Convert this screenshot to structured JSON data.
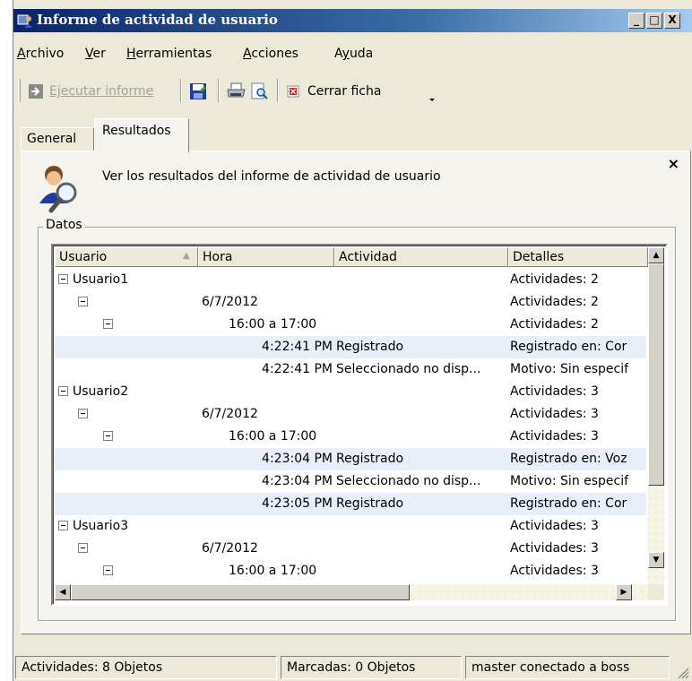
{
  "window": {
    "title": "Informe de actividad de usuario",
    "minimize": "_",
    "maximize": "□",
    "close": "X"
  },
  "menu": [
    {
      "label": "Archivo",
      "accel": "A",
      "rest": "rchivo"
    },
    {
      "label": "Ver",
      "accel": "V",
      "rest": "er"
    },
    {
      "label": "Herramientas",
      "accel": "H",
      "rest": "erramientas"
    },
    {
      "label": "Acciones",
      "accel": "A",
      "rest": "cciones"
    },
    {
      "label": "Ayuda",
      "accel": "y",
      "rest_before": "A",
      "rest": "uda"
    }
  ],
  "toolbar": {
    "run_report": "Ejecutar informe",
    "close_tab": "Cerrar ficha",
    "icons": [
      "run-arrow-icon",
      "save-icon",
      "print-icon",
      "print-preview-icon",
      "close-tab-icon",
      "overflow-chevron-icon"
    ]
  },
  "tabs": {
    "general": "General",
    "results": "Resultados"
  },
  "panel": {
    "description": "Ver los resultados del informe de actividad de usuario",
    "close": "×",
    "group_label": "Datos"
  },
  "list": {
    "columns": [
      "Usuario",
      "Hora",
      "Actividad",
      "Detalles"
    ],
    "sort_indicator": "▲",
    "rows": [
      {
        "level": 0,
        "user": "Usuario1",
        "time": "",
        "activity": "",
        "details": "Actividades: 2",
        "highlight": false
      },
      {
        "level": 1,
        "user": "",
        "time": "6/7/2012",
        "activity": "",
        "details": "Actividades: 2",
        "highlight": false
      },
      {
        "level": 2,
        "user": "",
        "time": "16:00 a 17:00",
        "activity": "",
        "details": "Actividades: 2",
        "highlight": false
      },
      {
        "level": 3,
        "user": "",
        "time": "4:22:41 PM",
        "activity": "Registrado",
        "details": "Registrado en: Cor",
        "highlight": true
      },
      {
        "level": 3,
        "user": "",
        "time": "4:22:41 PM",
        "activity": "Seleccionado no disp...",
        "details": "Motivo: Sin especif",
        "highlight": false
      },
      {
        "level": 0,
        "user": "Usuario2",
        "time": "",
        "activity": "",
        "details": "Actividades: 3",
        "highlight": false
      },
      {
        "level": 1,
        "user": "",
        "time": "6/7/2012",
        "activity": "",
        "details": "Actividades: 3",
        "highlight": false
      },
      {
        "level": 2,
        "user": "",
        "time": "16:00 a 17:00",
        "activity": "",
        "details": "Actividades: 3",
        "highlight": false
      },
      {
        "level": 3,
        "user": "",
        "time": "4:23:04 PM",
        "activity": "Registrado",
        "details": "Registrado en: Voz",
        "highlight": true
      },
      {
        "level": 3,
        "user": "",
        "time": "4:23:04 PM",
        "activity": "Seleccionado no disp...",
        "details": "Motivo: Sin especif",
        "highlight": false
      },
      {
        "level": 3,
        "user": "",
        "time": "4:23:05 PM",
        "activity": "Registrado",
        "details": "Registrado en: Cor",
        "highlight": true
      },
      {
        "level": 0,
        "user": "Usuario3",
        "time": "",
        "activity": "",
        "details": "Actividades: 3",
        "highlight": false
      },
      {
        "level": 1,
        "user": "",
        "time": "6/7/2012",
        "activity": "",
        "details": "Actividades: 3",
        "highlight": false
      },
      {
        "level": 2,
        "user": "",
        "time": "16:00 a 17:00",
        "activity": "",
        "details": "Actividades: 3",
        "highlight": false
      }
    ]
  },
  "scroll": {
    "up": "▲",
    "down": "▼",
    "left": "◀",
    "right": "▶"
  },
  "status": {
    "activities": "Actividades: 8 Objetos",
    "marked": "Marcadas: 0 Objetos",
    "connection": "master conectado a boss"
  },
  "colors": {
    "title_start": "#0a246a",
    "title_end": "#a6caf0",
    "highlight_row": "#e9eff8",
    "face": "#ece9d8"
  }
}
